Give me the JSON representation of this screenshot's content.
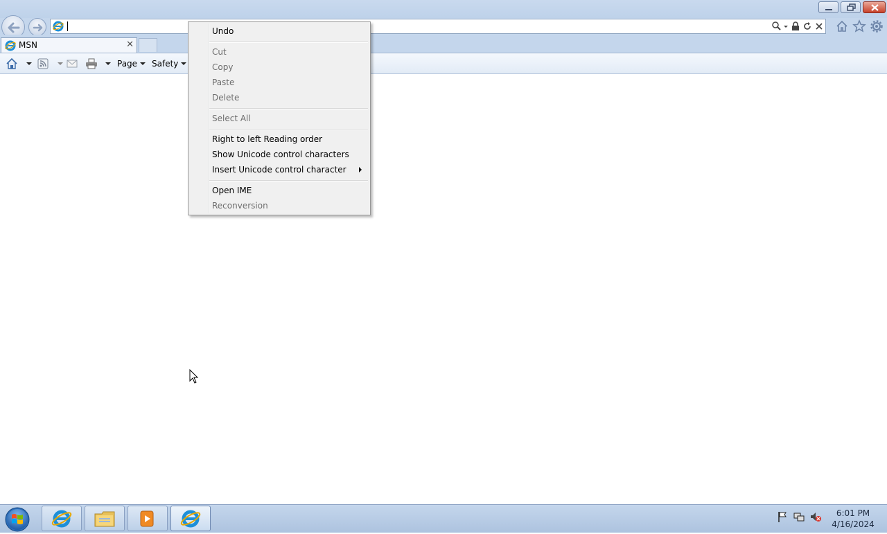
{
  "browser": {
    "address": {
      "value": "",
      "placeholder": ""
    },
    "tab": {
      "title": "MSN"
    },
    "command_bar": {
      "page_label": "Page",
      "safety_label": "Safety"
    }
  },
  "context_menu": {
    "items": [
      {
        "label": "Undo",
        "enabled": true
      },
      {
        "label": "Cut",
        "enabled": false
      },
      {
        "label": "Copy",
        "enabled": false
      },
      {
        "label": "Paste",
        "enabled": false
      },
      {
        "label": "Delete",
        "enabled": false
      },
      {
        "label": "Select All",
        "enabled": false
      },
      {
        "label": "Right to left Reading order",
        "enabled": true
      },
      {
        "label": "Show Unicode control characters",
        "enabled": true
      },
      {
        "label": "Insert Unicode control character",
        "enabled": true,
        "submenu": true
      },
      {
        "label": "Open IME",
        "enabled": true
      },
      {
        "label": "Reconversion",
        "enabled": false
      }
    ]
  },
  "taskbar": {
    "clock": {
      "time": "6:01 PM",
      "date": "4/16/2024"
    },
    "buttons": [
      "internet-explorer",
      "windows-explorer",
      "media-player",
      "internet-explorer-active"
    ]
  },
  "colors": {
    "chrome": "#c4d6ec",
    "menu_bg": "#f0f0f0",
    "disabled_text": "#6d6d6d",
    "ie_blue": "#1d8fd8",
    "close_red": "#c8432b"
  }
}
